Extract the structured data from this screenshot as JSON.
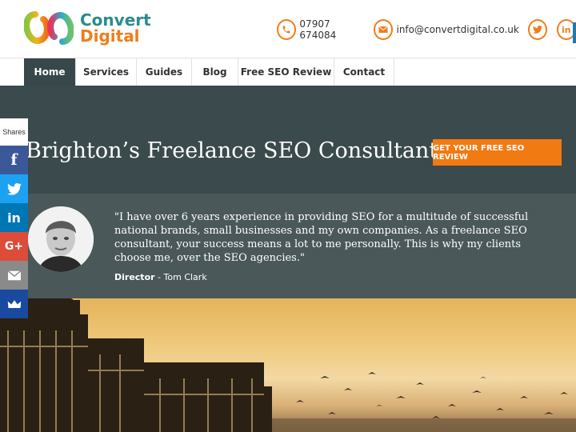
{
  "brand": {
    "line1": "Convert",
    "line2": "Digital"
  },
  "contact": {
    "phone": "07907 674084",
    "email": "info@convertdigital.co.uk"
  },
  "nav": {
    "items": [
      {
        "label": "Home",
        "active": true
      },
      {
        "label": "Services",
        "active": false
      },
      {
        "label": "Guides",
        "active": false
      },
      {
        "label": "Blog",
        "active": false
      },
      {
        "label": "Free SEO Review",
        "active": false
      },
      {
        "label": "Contact",
        "active": false
      }
    ]
  },
  "hero": {
    "title": "Brighton’s Freelance SEO Consultant",
    "cta": "GET YOUR FREE SEO REVIEW"
  },
  "testimonial": {
    "quote": "\"I have over 6 years experience in providing SEO for a multitude of successful national brands, small businesses and my own companies. As a freelance SEO consultant, your success means a lot to me personally. This is why my clients choose me, over the SEO agencies.\"",
    "role": "Director",
    "separator": " - ",
    "name": "Tom Clark"
  },
  "share": {
    "label": "Shares",
    "buttons": [
      {
        "name": "facebook-icon",
        "glyph": "f",
        "color": "#3b5998"
      },
      {
        "name": "twitter-icon",
        "glyph": "",
        "color": "#1da1f2"
      },
      {
        "name": "linkedin-icon",
        "glyph": "in",
        "color": "#0077b5"
      },
      {
        "name": "googleplus-icon",
        "glyph": "G+",
        "color": "#dd4b39"
      },
      {
        "name": "email-icon",
        "glyph": "",
        "color": "#8a8a8a"
      },
      {
        "name": "crown-icon",
        "glyph": "",
        "color": "#1a4aa0"
      }
    ]
  },
  "colors": {
    "accent": "#f07d1a",
    "teal": "#2a8c8c",
    "hero_bg": "#3b4a4c",
    "testimonial_bg": "#4a585a"
  }
}
